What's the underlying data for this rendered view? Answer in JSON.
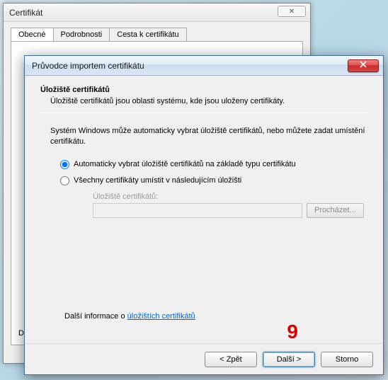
{
  "background_window": {
    "title": "Certifikát",
    "close_glyph": "✕",
    "tabs": [
      "Obecné",
      "Podrobnosti",
      "Cesta k certifikátu"
    ],
    "corner_text": "D"
  },
  "wizard": {
    "title": "Průvodce importem certifikátu",
    "section_title": "Úložiště certifikátů",
    "section_desc": "Úložiště certifikátů jsou oblasti systému, kde jsou uloženy certifikáty.",
    "instruction": "Systém Windows může automaticky vybrat úložiště certifikátů, nebo můžete zadat umístění certifikátu.",
    "radio_auto": "Automaticky vybrat úložiště certifikátů na základě typu certifikátu",
    "radio_manual": "Všechny certifikáty umístit v následujícím úložišti",
    "store_label": "Úložiště certifikátů:",
    "browse": "Procházet...",
    "more_info_prefix": "Další informace o ",
    "more_info_link": "úložištích certifikátů",
    "buttons": {
      "back": "< Zpět",
      "next": "Další >",
      "cancel": "Storno"
    }
  },
  "annotation": "9"
}
